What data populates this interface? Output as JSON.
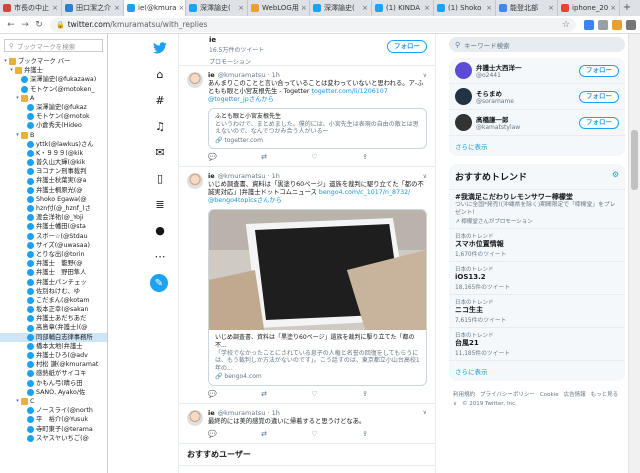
{
  "tabs": [
    {
      "label": "市長の中止",
      "color": "#d0453d"
    },
    {
      "label": "田口潔之介",
      "color": "#2f80d1"
    },
    {
      "label": "ie(@kmura",
      "color": "#1da1f2",
      "active": true
    },
    {
      "label": "深澤諭史(",
      "color": "#1da1f2"
    },
    {
      "label": "WebLOG用",
      "color": "#e8a030"
    },
    {
      "label": "深澤諭史(",
      "color": "#1da1f2"
    },
    {
      "label": "(1) KINDA",
      "color": "#1da1f2"
    },
    {
      "label": "(1) Shoko",
      "color": "#1da1f2"
    },
    {
      "label": "能登北部",
      "color": "#4285f4"
    },
    {
      "label": "iphone_20",
      "color": "#ea4335"
    }
  ],
  "address": {
    "host": "twitter.com",
    "path": "/kmuramatsu/with_replies"
  },
  "bookmarks": {
    "search_placeholder": "ブックマークを検索",
    "rows": [
      {
        "label": "ブックマーク バー",
        "type": "folder",
        "indent": 0,
        "open": true
      },
      {
        "label": "弁護士",
        "type": "folder",
        "indent": 1,
        "open": true
      },
      {
        "label": "深澤諭史(@fukazawa)",
        "type": "tw",
        "indent": 2
      },
      {
        "label": "モトケン(@motoken_",
        "type": "tw",
        "indent": 2
      },
      {
        "label": "A",
        "type": "folder",
        "indent": 2,
        "open": true
      },
      {
        "label": "深澤諭史(@fukaz",
        "type": "tw",
        "indent": 3
      },
      {
        "label": "モトケン(@motok",
        "type": "tw",
        "indent": 3
      },
      {
        "label": "小倉秀夫(Hideo",
        "type": "tw",
        "indent": 3
      },
      {
        "label": "B",
        "type": "folder",
        "indent": 2,
        "open": true
      },
      {
        "label": "yttk(@lawkus)さん",
        "type": "tw",
        "indent": 3
      },
      {
        "label": "K・９９９(@kik",
        "type": "tw",
        "indent": 3
      },
      {
        "label": "普久山大輝(@kik",
        "type": "tw",
        "indent": 3
      },
      {
        "label": "ヨコナン刑事裁判",
        "type": "tw",
        "indent": 3
      },
      {
        "label": "弁護士秋葉実(@a",
        "type": "tw",
        "indent": 3
      },
      {
        "label": "弁護士桐原光(@",
        "type": "tw",
        "indent": 3
      },
      {
        "label": "Shoko Egawa(@",
        "type": "tw",
        "indent": 3
      },
      {
        "label": "hzn付(@_hznf_)さ",
        "type": "tw",
        "indent": 3
      },
      {
        "label": "渡会洋祐(@_Yoji",
        "type": "tw",
        "indent": 3
      },
      {
        "label": "弁護士幡田(@sta",
        "type": "tw",
        "indent": 3
      },
      {
        "label": "スボー☆(@Stdau",
        "type": "tw",
        "indent": 3
      },
      {
        "label": "サイズ(@uwasaa)",
        "type": "tw",
        "indent": 3
      },
      {
        "label": "とりな出(@torin",
        "type": "tw",
        "indent": 3
      },
      {
        "label": "弁護士　籠野(@",
        "type": "tw",
        "indent": 3
      },
      {
        "label": "弁護士　野田隼人",
        "type": "tw",
        "indent": 3
      },
      {
        "label": "弁護士パンチェッ",
        "type": "tw",
        "indent": 3
      },
      {
        "label": "佐別ねけむ、ゆ",
        "type": "tw",
        "indent": 3
      },
      {
        "label": "こだまん(@kotam",
        "type": "tw",
        "indent": 3
      },
      {
        "label": "坂本正幸(@sakan",
        "type": "tw",
        "indent": 3
      },
      {
        "label": "弁護士あだちあだ",
        "type": "tw",
        "indent": 3
      },
      {
        "label": "高島章(弁護士)(@",
        "type": "tw",
        "indent": 3
      },
      {
        "label": "同部輔白志律事務所",
        "type": "tw",
        "indent": 3,
        "selected": true
      },
      {
        "label": "橋本太地(弁護士",
        "type": "tw",
        "indent": 3
      },
      {
        "label": "弁護士ひろ(@adv",
        "type": "tw",
        "indent": 3
      },
      {
        "label": "村松 謙(@kmuramat",
        "type": "tw",
        "indent": 3
      },
      {
        "label": "感熱紙がサイコキ",
        "type": "tw",
        "indent": 3
      },
      {
        "label": "かもん弓(晴ら田",
        "type": "tw",
        "indent": 3
      },
      {
        "label": "SANO, Ayako/佐",
        "type": "tw",
        "indent": 3
      },
      {
        "label": "C",
        "type": "folder",
        "indent": 2,
        "open": true
      },
      {
        "label": "ノースライ(@north",
        "type": "tw",
        "indent": 3
      },
      {
        "label": "平　裕介(@Yusuk",
        "type": "tw",
        "indent": 3
      },
      {
        "label": "寺町東子(@terama",
        "type": "tw",
        "indent": 3
      },
      {
        "label": "スヤスヤいちご(@",
        "type": "tw",
        "indent": 3
      }
    ]
  },
  "top_card": {
    "name": "ie",
    "sub": "16.5万件のツイート",
    "promo": "プロモーション",
    "follow_label": "フォロー"
  },
  "tweets": [
    {
      "name": "ie",
      "handle": "@kmuramatsu · 1h",
      "text": "あんまりこのことと言い合っていることは変わっていないと思われる。ア-ふともも眼と小宮友根先生 - Togetter",
      "link": "togetter.com/li/1206107 @togetter_jpさんから",
      "card_title": "ふとも眼と小宮友根先生",
      "card_desc": "というわけで、まとめました。僕的には、小宮先生は表現の自由の敵とは思えないので、なんでつかみ合う人がいるー",
      "card_url": "togetter.com",
      "has_image": false,
      "actions": {
        "reply": "",
        "retweet": "",
        "like": ""
      }
    },
    {
      "name": "ie",
      "handle": "@kmuramatsu · 1h",
      "text": "いじめ調査書、資料は「黒塗り60ページ」遺族を裁判に駆り立てた「都の不誠実対応」|弁護士ドットコムニュース",
      "link": "bengo4.com/c_1017/n_8732/ @bengo4topicsさんから",
      "card_title": "いじめ調査書、資料は「黒塗り60ページ」遺族を裁判に駆り立てた「都の不...",
      "card_desc": "「学校でなかったことにされている息子の人権と名誉の回復をしてもらうには、もう裁判しか方法がないのです」。こう話すのは、東京都立小山台高校1年の...",
      "card_url": "bengo4.com",
      "has_image": true,
      "actions": {
        "reply": "",
        "retweet": "",
        "like": ""
      }
    },
    {
      "name": "ie",
      "handle": "@kmuramatsu · 1h",
      "text": "最終的には美的感覚の違いに帰着すると思うけどなあ。",
      "link": "",
      "has_image": false,
      "actions": {
        "reply": "",
        "retweet": "",
        "like": ""
      }
    }
  ],
  "recommend_header": "おすすめユーザー",
  "right": {
    "search_placeholder": "キーワード検索",
    "who_to_follow": [
      {
        "name": "弁護士大西洋一",
        "handle": "@o2441",
        "follow": "フォロー",
        "avatar_color": "#5b4bd6"
      },
      {
        "name": "そらまめ",
        "handle": "@soramame",
        "follow": "フォロー",
        "avatar_color": "#223344"
      },
      {
        "name": "髙橋謙一郎",
        "handle": "@kamatstylaw",
        "follow": "フォロー",
        "avatar_color": "#333333"
      }
    ],
    "show_more": "さらに表示",
    "trends_title": "おすすめトレンド",
    "trends": [
      {
        "ctx": "",
        "title": "#我満足こだわりレモンサワー檸檬堂",
        "desc": "ついに全国*発売!(沖縄県を除く)期間限定で「檸檬堂」をプレゼント!",
        "count": "",
        "promo": "檸檬堂さんがプロモーション"
      },
      {
        "ctx": "日本のトレンド",
        "title": "スマホ位置情報",
        "desc": "",
        "count": "1,670件のツイート",
        "promo": ""
      },
      {
        "ctx": "日本のトレンド",
        "title": "iOS13.2",
        "desc": "",
        "count": "18,165件のツイート",
        "promo": ""
      },
      {
        "ctx": "日本のトレンド",
        "title": "ニコ生主",
        "desc": "",
        "count": "7,615件のツイート",
        "promo": ""
      },
      {
        "ctx": "日本のトレンド",
        "title": "台風21",
        "desc": "",
        "count": "11,185件のツイート",
        "promo": ""
      }
    ],
    "trends_more": "さらに表示",
    "footer": [
      "利用規約",
      "プライバシーポリシー",
      "Cookie",
      "広告情報",
      "もっと見る ∨",
      "© 2019 Twitter, Inc."
    ]
  },
  "colors": {
    "accent": "#1da1f2",
    "link": "#1b95e0",
    "muted": "#657786"
  }
}
